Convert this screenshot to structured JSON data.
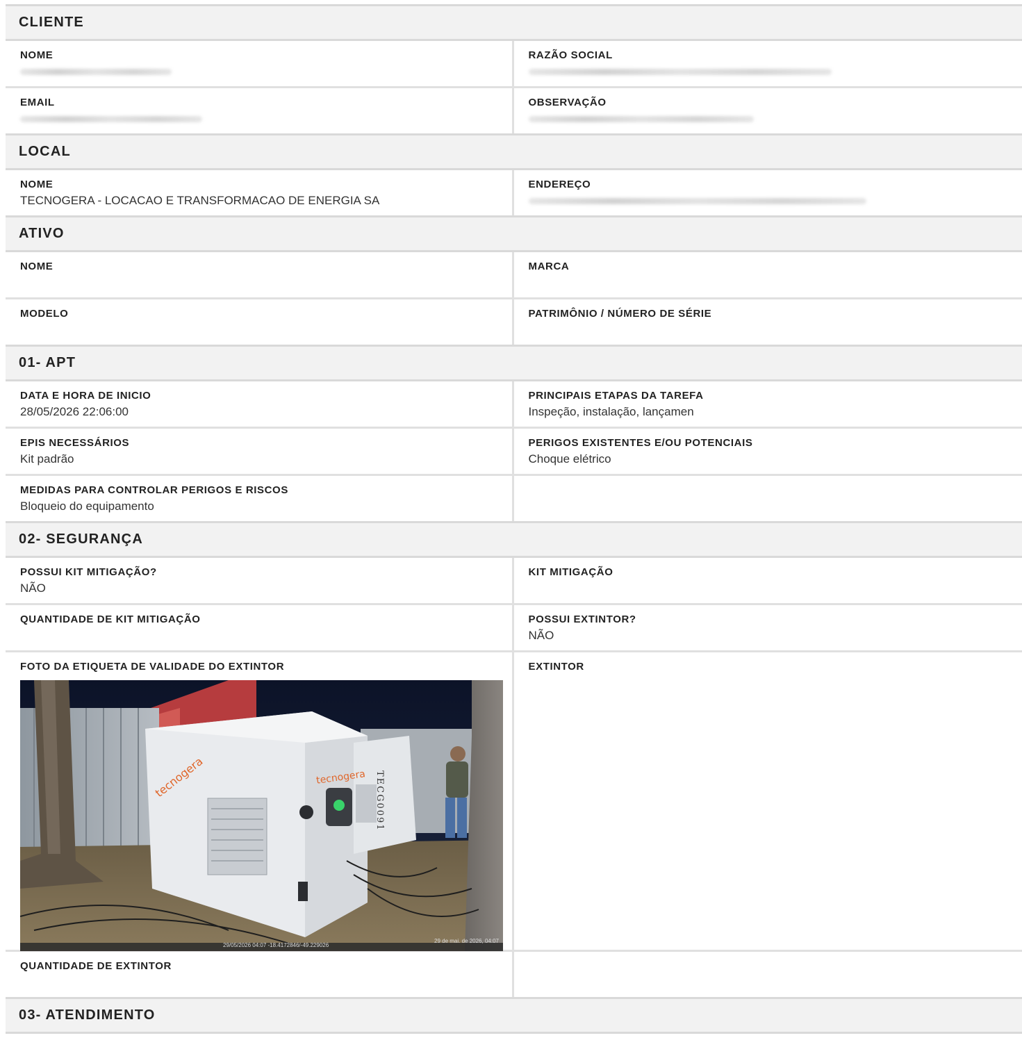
{
  "sections": {
    "cliente": {
      "title": "CLIENTE",
      "nome_label": "NOME",
      "razao_label": "RAZÃO SOCIAL",
      "email_label": "EMAIL",
      "observacao_label": "OBSERVAÇÃO"
    },
    "local": {
      "title": "LOCAL",
      "nome_label": "NOME",
      "nome_value": "TECNOGERA - LOCACAO E TRANSFORMACAO DE ENERGIA SA",
      "endereco_label": "ENDEREÇO"
    },
    "ativo": {
      "title": "ATIVO",
      "nome_label": "NOME",
      "marca_label": "MARCA",
      "modelo_label": "MODELO",
      "patrimonio_label": "PATRIMÔNIO / NÚMERO DE SÉRIE"
    },
    "apt": {
      "title": "01- APT",
      "inicio_label": "DATA E HORA DE INICIO",
      "inicio_value": "28/05/2026 22:06:00",
      "etapas_label": "PRINCIPAIS ETAPAS DA TAREFA",
      "etapas_value": "Inspeção, instalação, lançamen",
      "epis_label": "EPIS NECESSÁRIOS",
      "epis_value": "Kit padrão",
      "perigos_label": "PERIGOS EXISTENTES E/OU POTENCIAIS",
      "perigos_value": "Choque elétrico",
      "medidas_label": "MEDIDAS PARA CONTROLAR PERIGOS E RISCOS",
      "medidas_value": "Bloqueio do equipamento"
    },
    "seguranca": {
      "title": "02- SEGURANÇA",
      "possui_kit_label": "POSSUI KIT MITIGAÇÃO?",
      "possui_kit_value": "NÃO",
      "kit_label": "KIT MITIGAÇÃO",
      "qtd_kit_label": "QUANTIDADE DE KIT MITIGAÇÃO",
      "possui_extintor_label": "POSSUI EXTINTOR?",
      "possui_extintor_value": "NÃO",
      "foto_label": "FOTO DA ETIQUETA DE VALIDADE DO EXTINTOR",
      "extintor_label": "EXTINTOR",
      "qtd_extintor_label": "QUANTIDADE DE EXTINTOR"
    },
    "atendimento": {
      "title": "03- ATENDIMENTO"
    }
  },
  "photo": {
    "brand_text": "tecnogera",
    "unit_code": "TECG0091",
    "stamp_left": "29/05/2026 04:07 -18.4172846/-49.229026",
    "stamp_right": "29 de mai. de 2026, 04:07"
  },
  "colors": {
    "header_bg": "#f2f2f2",
    "border": "#d9d9d9",
    "brand_orange": "#e0662a"
  }
}
